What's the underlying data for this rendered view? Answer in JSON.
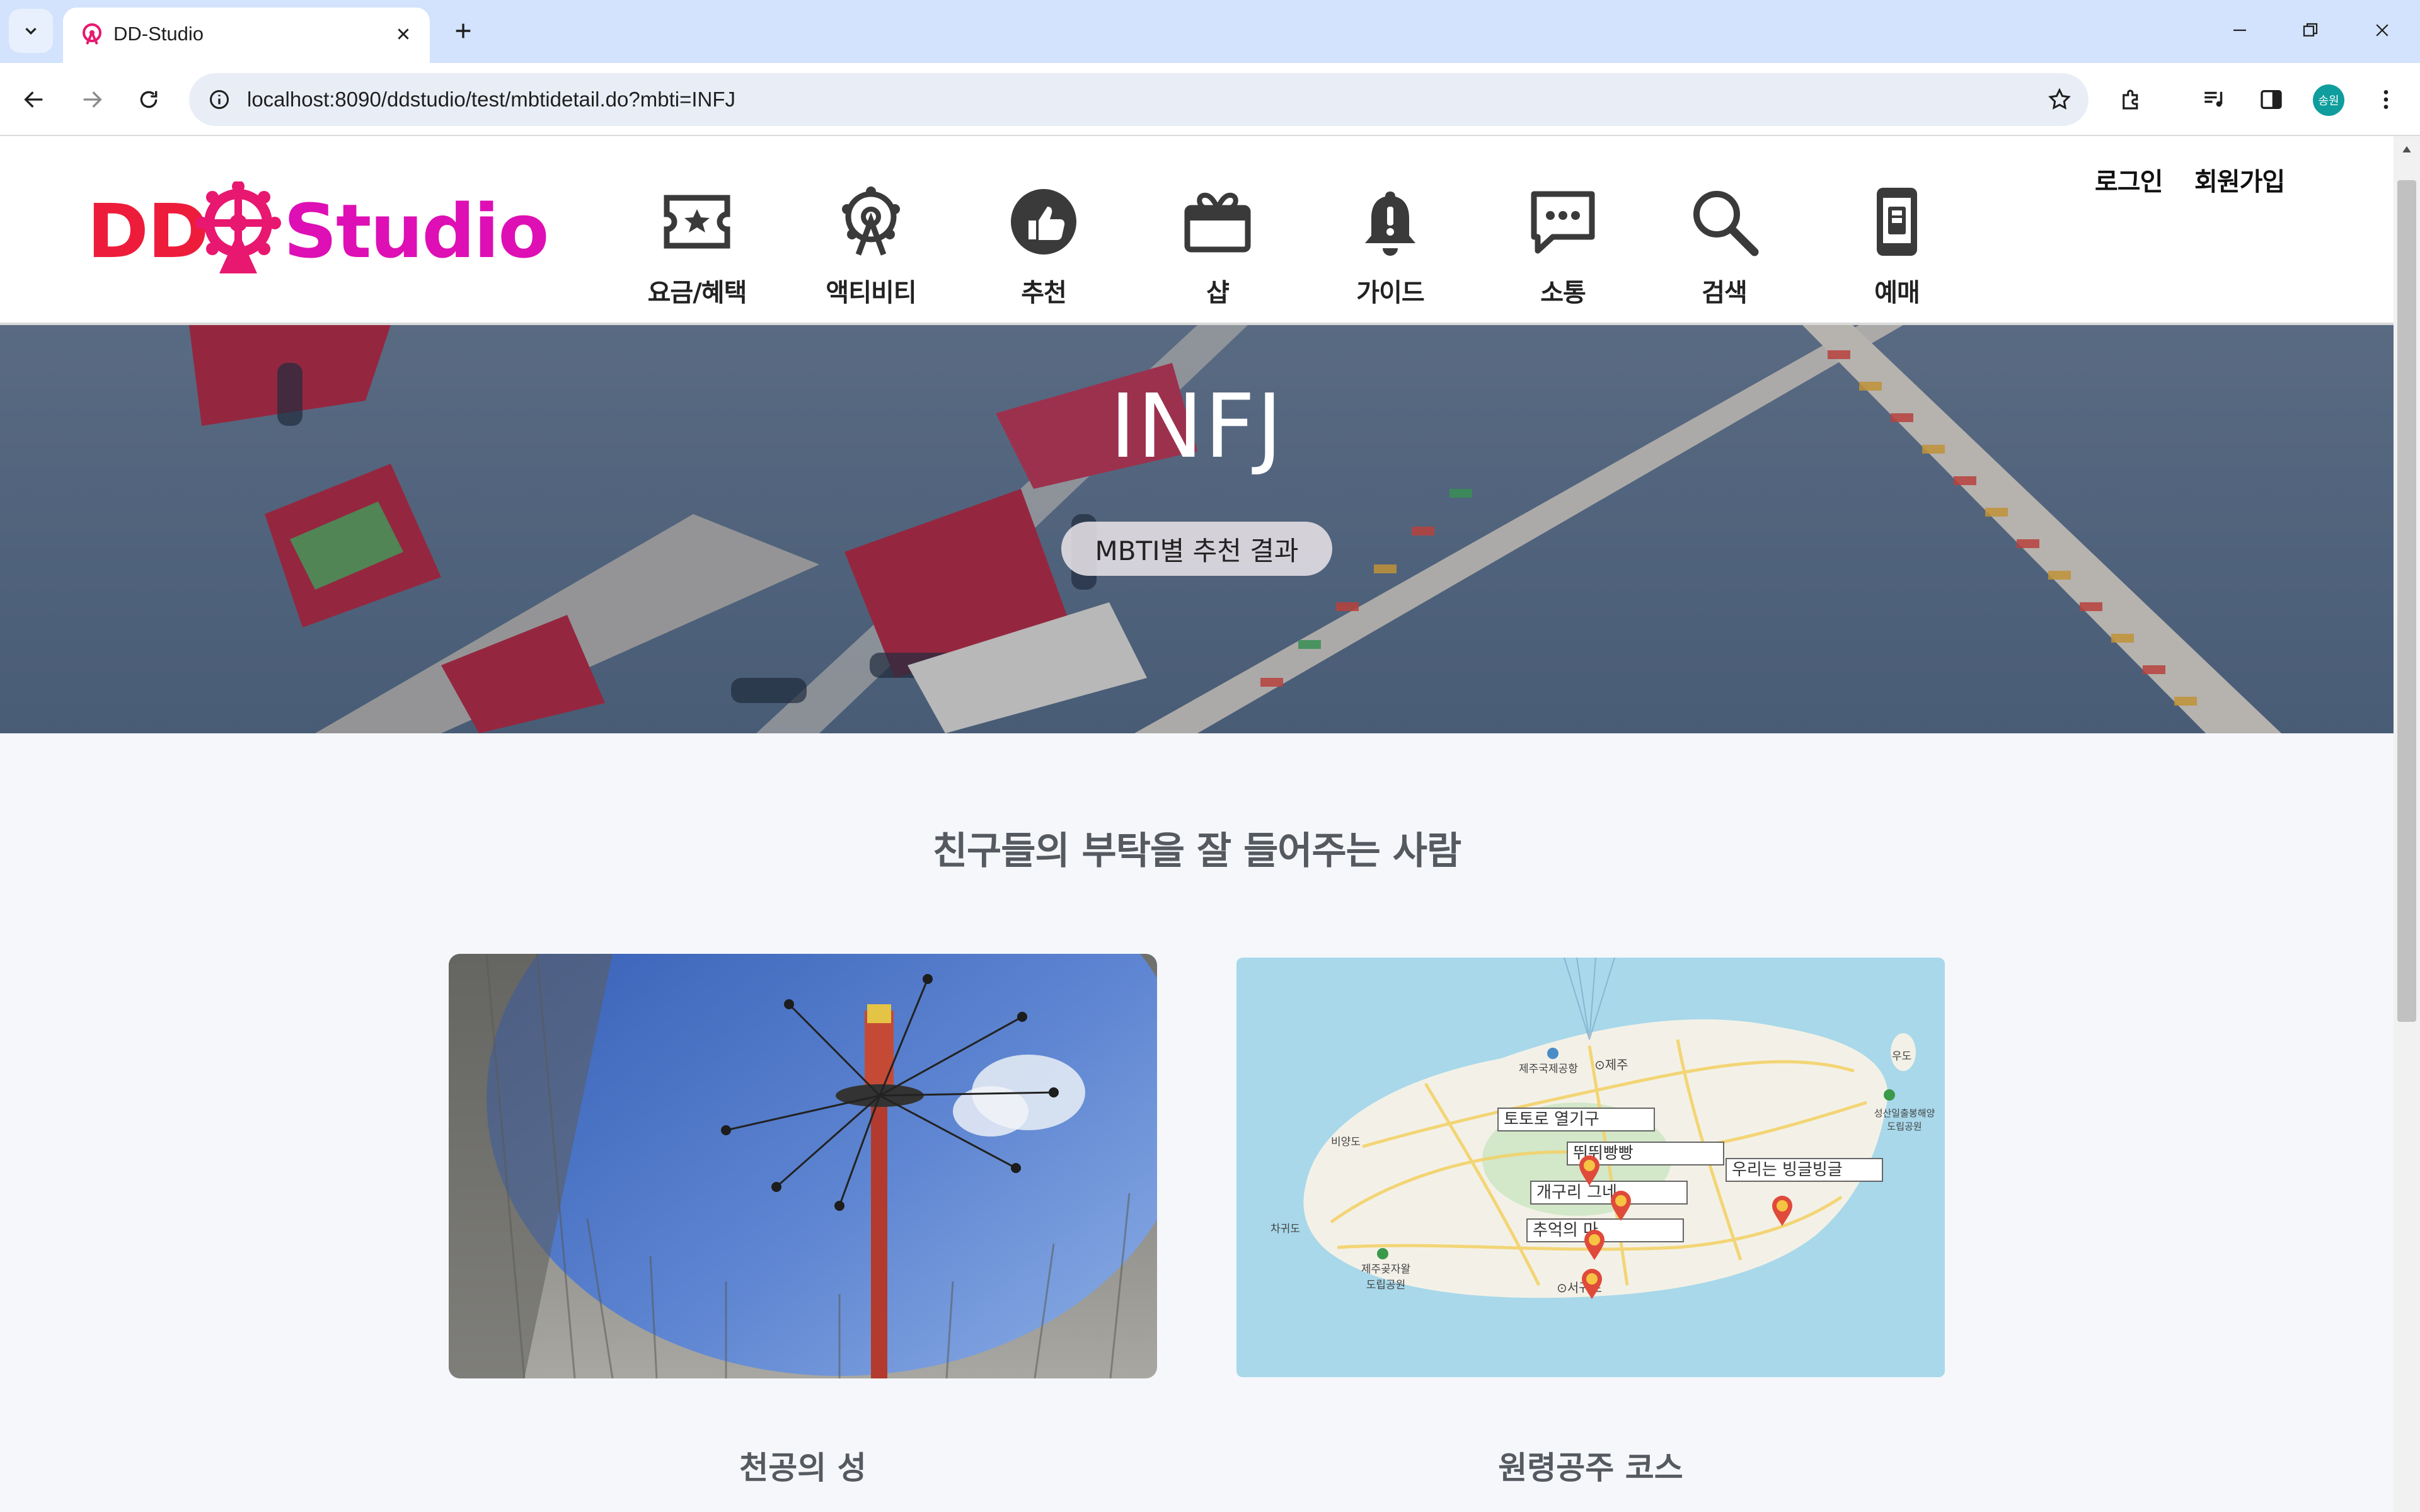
{
  "browser": {
    "tab_title": "DD-Studio",
    "url": "localhost:8090/ddstudio/test/mbtidetail.do?mbti=INFJ",
    "profile_initials": "송원"
  },
  "site": {
    "logo_dd": "DD",
    "logo_studio": "Studio",
    "nav": [
      {
        "label": "요금/혜택",
        "icon": "ticket-star-icon"
      },
      {
        "label": "액티비티",
        "icon": "ferris-wheel-icon"
      },
      {
        "label": "추천",
        "icon": "thumbs-up-icon"
      },
      {
        "label": "샵",
        "icon": "gift-box-icon"
      },
      {
        "label": "가이드",
        "icon": "bell-alert-icon"
      },
      {
        "label": "소통",
        "icon": "chat-bubble-icon"
      },
      {
        "label": "검색",
        "icon": "search-icon"
      },
      {
        "label": "예매",
        "icon": "mobile-phone-icon"
      }
    ],
    "auth": {
      "login": "로그인",
      "signup": "회원가입"
    },
    "colors": {
      "logo_red": "#ee1c3b",
      "logo_magenta": "#d400c8",
      "text_gray": "#555a60"
    }
  },
  "hero": {
    "title": "INFJ",
    "badge": "MBTI별 추천 결과"
  },
  "content": {
    "subtitle": "친구들의 부탁을 잘 들어주는 사람",
    "cards": [
      {
        "caption": "천공의 성"
      },
      {
        "caption": "원령공주 코스"
      }
    ],
    "map": {
      "labels": [
        "토토로 열기구",
        "뛰뛰빵빵",
        "개구리 그네",
        "추억의 마",
        "우리는 빙글빙글"
      ],
      "places": [
        "제주국제공항",
        "⊙제주",
        "비양도",
        "차귀도",
        "제주곶자왈\n도립공원",
        "⊙서귀포",
        "성산일출봉해양\n도립공원",
        "우도"
      ]
    }
  }
}
